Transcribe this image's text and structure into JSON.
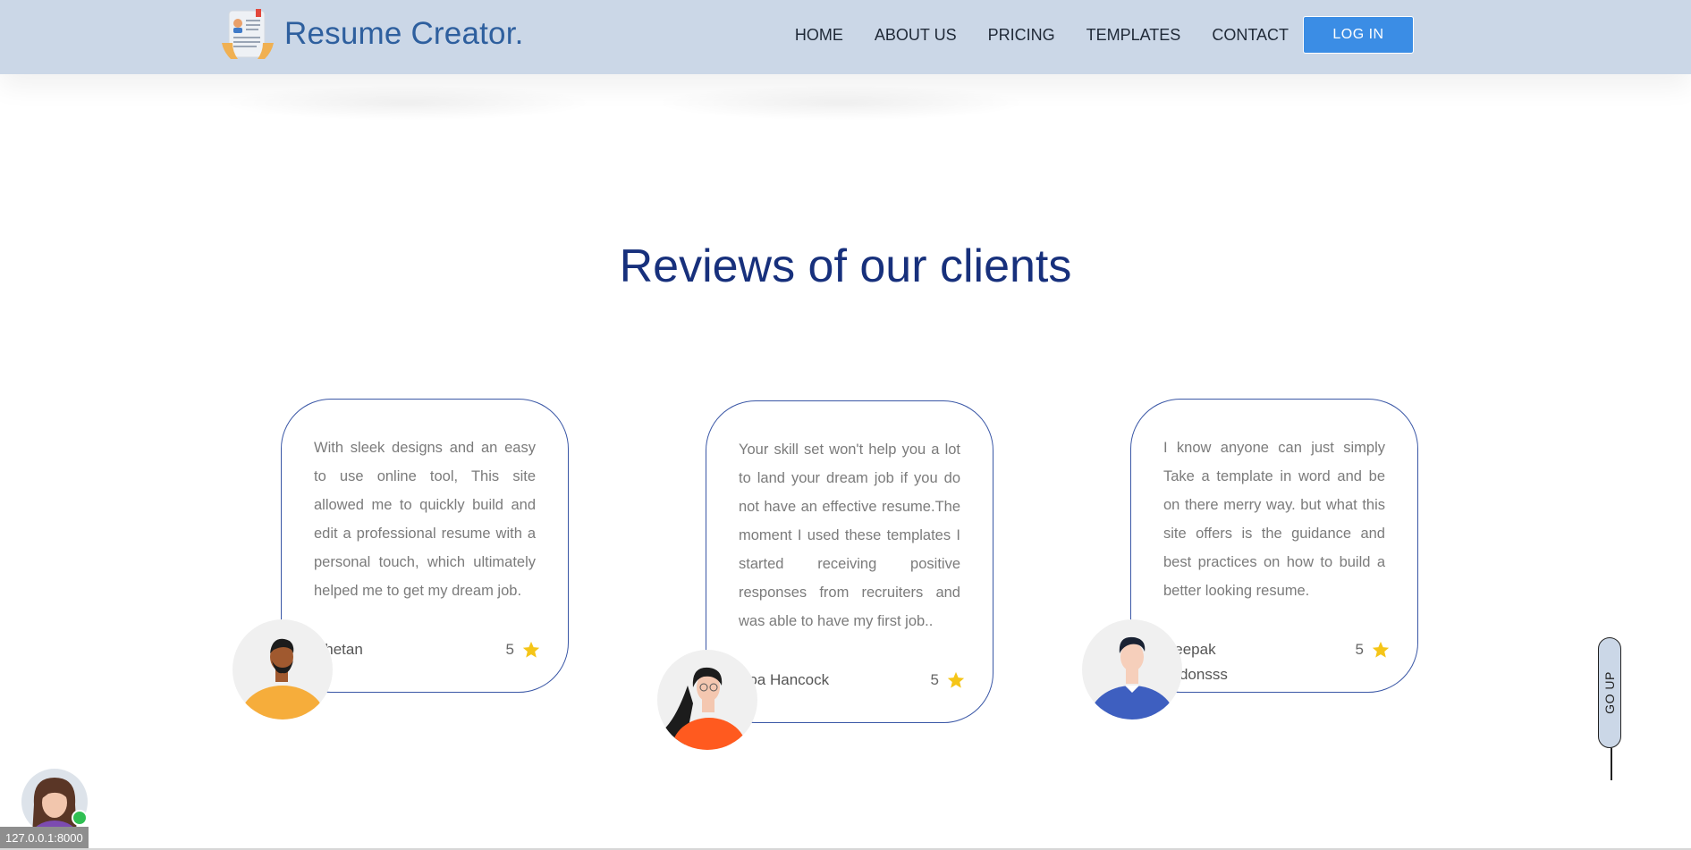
{
  "header": {
    "brand": "Resume Creator.",
    "nav": [
      "HOME",
      "ABOUT US",
      "PRICING",
      "TEMPLATES",
      "CONTACT"
    ],
    "login_label": "LOG IN"
  },
  "reviews": {
    "title": "Reviews of our clients",
    "items": [
      {
        "text": "With sleek designs and an easy to use online tool, This site allowed me to quickly build and edit a professional resume with a personal touch, which ultimately helped me to get my dream job.",
        "name": "Chetan",
        "rating": "5"
      },
      {
        "text": "Your skill set won't help you a lot to land your dream job if you do not have an effective resume.The moment I used these templates I started receiving positive responses from recruiters and was able to have my first job..",
        "name": "Boa Hancock",
        "rating": "5"
      },
      {
        "text": "I know anyone can just simply Take a template in word and be on there merry way. but what this site offers is the guidance and best practices on how to build a better looking resume.",
        "name": "Deepak Jadonsss",
        "rating": "5"
      }
    ]
  },
  "go_up_label": "GO UP",
  "status_url": "127.0.0.1:8000",
  "colors": {
    "header_bg": "#cbd7e7",
    "brand": "#2e5f9e",
    "title": "#17307c",
    "button": "#3b8de5",
    "card_border": "#3a57a6",
    "star": "#f5c518"
  }
}
